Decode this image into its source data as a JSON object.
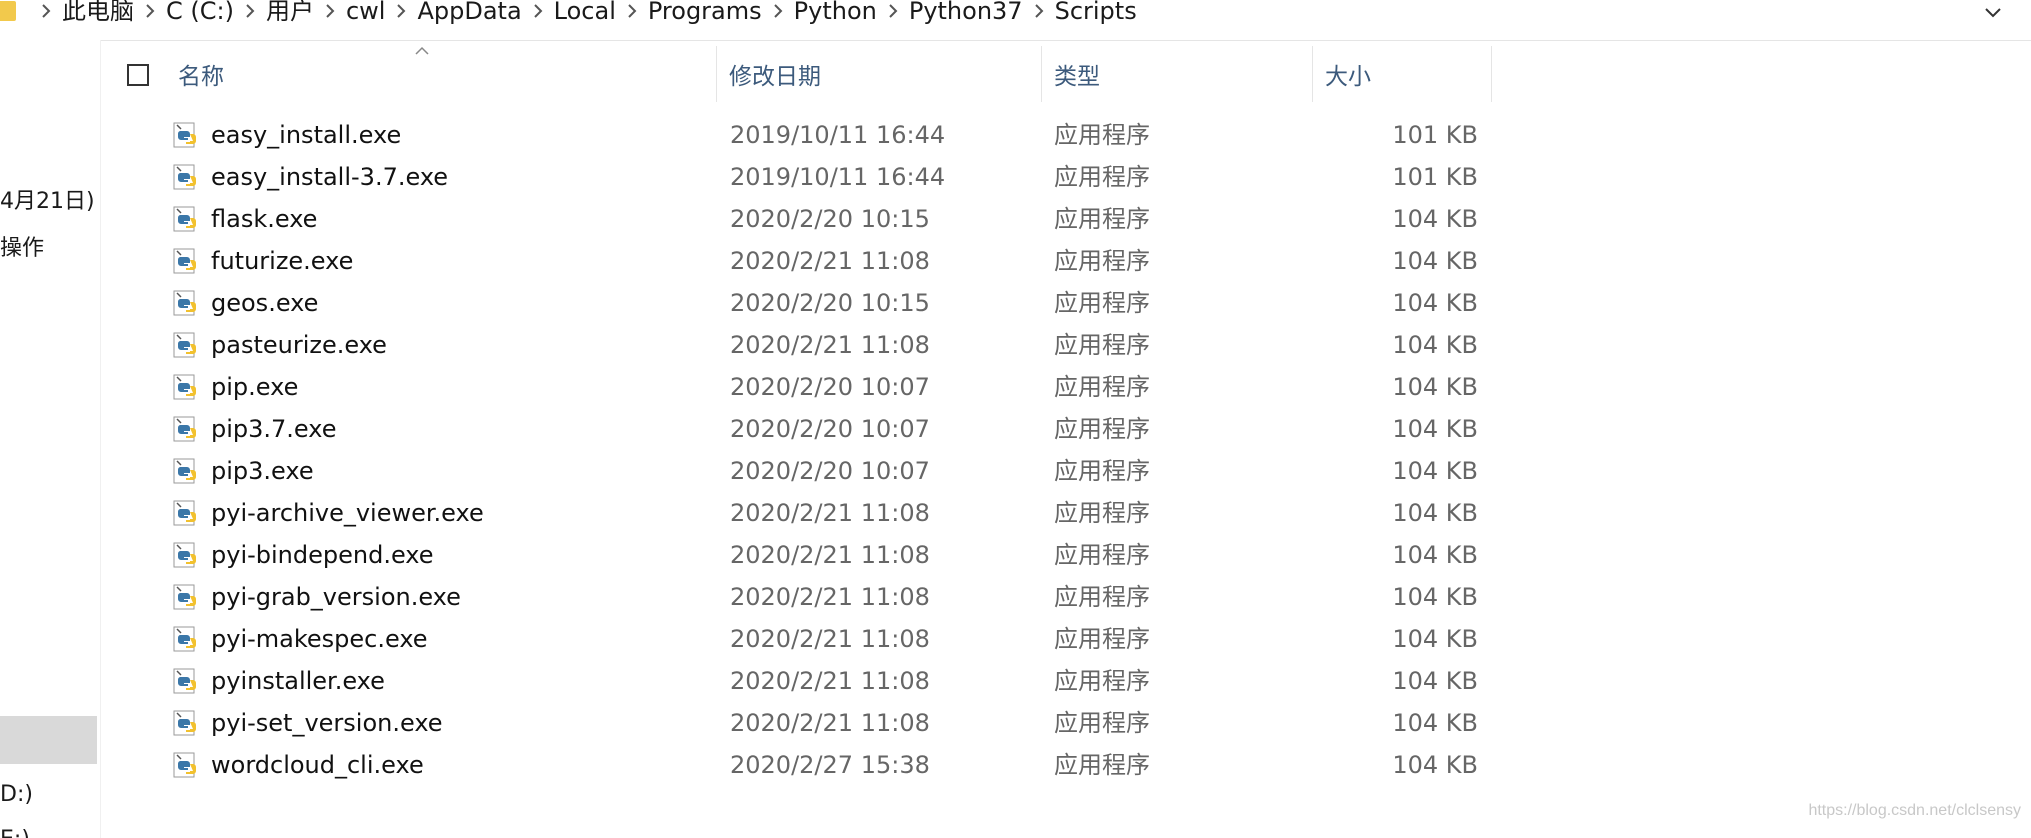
{
  "breadcrumb": [
    "此电脑",
    "C (C:)",
    "用户",
    "cwl",
    "AppData",
    "Local",
    "Programs",
    "Python",
    "Python37",
    "Scripts"
  ],
  "nav": {
    "item1": "4月21日)",
    "item2": "操作",
    "item3": "D:)",
    "item4": "E:)"
  },
  "columns": {
    "name": "名称",
    "date": "修改日期",
    "type": "类型",
    "size": "大小"
  },
  "files": [
    {
      "name": "easy_install.exe",
      "date": "2019/10/11 16:44",
      "type": "应用程序",
      "size": "101 KB"
    },
    {
      "name": "easy_install-3.7.exe",
      "date": "2019/10/11 16:44",
      "type": "应用程序",
      "size": "101 KB"
    },
    {
      "name": "flask.exe",
      "date": "2020/2/20 10:15",
      "type": "应用程序",
      "size": "104 KB"
    },
    {
      "name": "futurize.exe",
      "date": "2020/2/21 11:08",
      "type": "应用程序",
      "size": "104 KB"
    },
    {
      "name": "geos.exe",
      "date": "2020/2/20 10:15",
      "type": "应用程序",
      "size": "104 KB"
    },
    {
      "name": "pasteurize.exe",
      "date": "2020/2/21 11:08",
      "type": "应用程序",
      "size": "104 KB"
    },
    {
      "name": "pip.exe",
      "date": "2020/2/20 10:07",
      "type": "应用程序",
      "size": "104 KB"
    },
    {
      "name": "pip3.7.exe",
      "date": "2020/2/20 10:07",
      "type": "应用程序",
      "size": "104 KB"
    },
    {
      "name": "pip3.exe",
      "date": "2020/2/20 10:07",
      "type": "应用程序",
      "size": "104 KB"
    },
    {
      "name": "pyi-archive_viewer.exe",
      "date": "2020/2/21 11:08",
      "type": "应用程序",
      "size": "104 KB"
    },
    {
      "name": "pyi-bindepend.exe",
      "date": "2020/2/21 11:08",
      "type": "应用程序",
      "size": "104 KB"
    },
    {
      "name": "pyi-grab_version.exe",
      "date": "2020/2/21 11:08",
      "type": "应用程序",
      "size": "104 KB"
    },
    {
      "name": "pyi-makespec.exe",
      "date": "2020/2/21 11:08",
      "type": "应用程序",
      "size": "104 KB"
    },
    {
      "name": "pyinstaller.exe",
      "date": "2020/2/21 11:08",
      "type": "应用程序",
      "size": "104 KB"
    },
    {
      "name": "pyi-set_version.exe",
      "date": "2020/2/21 11:08",
      "type": "应用程序",
      "size": "104 KB"
    },
    {
      "name": "wordcloud_cli.exe",
      "date": "2020/2/27 15:38",
      "type": "应用程序",
      "size": "104 KB"
    }
  ],
  "watermark": "https://blog.csdn.net/clclsensy",
  "icons": {
    "folder": "folder-icon",
    "separator": "chevron-right-icon",
    "dropdown": "chevron-down-icon",
    "file": "python-exe-icon"
  }
}
